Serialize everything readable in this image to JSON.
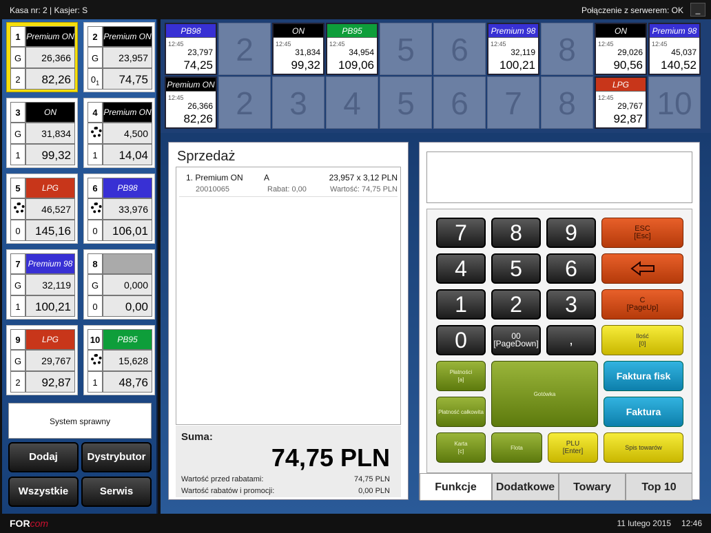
{
  "header": {
    "left": "Kasa nr: 2  |  Kasjer: S",
    "right": "Połączenie z serwerem: OK",
    "min_label": "_"
  },
  "colors": {
    "black": "#000000",
    "red": "#c8361a",
    "blue": "#3830d4",
    "green": "#0e9e3a",
    "gray": "#aaaaaa"
  },
  "pumps": [
    {
      "n": "1",
      "fuel": "Premium ON",
      "fc": "black",
      "g": "G",
      "vol": "26,366",
      "noz": "2",
      "amt": "82,26",
      "sel": true,
      "spin": false
    },
    {
      "n": "2",
      "fuel": "Premium ON",
      "fc": "black",
      "g": "G",
      "vol": "23,957",
      "noz": "0",
      "noz_sub": "1",
      "amt": "74,75",
      "sel": false,
      "spin": false
    },
    {
      "n": "3",
      "fuel": "ON",
      "fc": "black",
      "g": "G",
      "vol": "31,834",
      "noz": "1",
      "amt": "99,32",
      "sel": false,
      "spin": false
    },
    {
      "n": "4",
      "fuel": "Premium ON",
      "fc": "black",
      "g": "",
      "vol": "4,500",
      "noz": "1",
      "amt": "14,04",
      "sel": false,
      "spin": true
    },
    {
      "n": "5",
      "fuel": "LPG",
      "fc": "red",
      "g": "",
      "vol": "46,527",
      "noz": "0",
      "amt": "145,16",
      "sel": false,
      "spin": true
    },
    {
      "n": "6",
      "fuel": "PB98",
      "fc": "blue",
      "g": "",
      "vol": "33,976",
      "noz": "0",
      "amt": "106,01",
      "sel": false,
      "spin": true
    },
    {
      "n": "7",
      "fuel": "Premium 98",
      "fc": "blue",
      "g": "G",
      "vol": "32,119",
      "noz": "1",
      "amt": "100,21",
      "sel": false,
      "spin": false
    },
    {
      "n": "8",
      "fuel": "",
      "fc": "gray",
      "g": "G",
      "vol": "0,000",
      "noz": "0",
      "amt": "0,00",
      "sel": false,
      "spin": false
    },
    {
      "n": "9",
      "fuel": "LPG",
      "fc": "red",
      "g": "G",
      "vol": "29,767",
      "noz": "2",
      "amt": "92,87",
      "sel": false,
      "spin": false
    },
    {
      "n": "10",
      "fuel": "PB95",
      "fc": "green",
      "g": "",
      "vol": "15,628",
      "noz": "1",
      "amt": "48,76",
      "sel": false,
      "spin": true
    }
  ],
  "status": "System sprawny",
  "left_buttons": [
    "Dodaj",
    "Dystrybutor",
    "Wszystkie",
    "Serwis"
  ],
  "transactions_row1": [
    {
      "fuel": "PB98",
      "fc": "blue",
      "time": "12:45",
      "vol": "23,797",
      "amt": "74,25"
    },
    {
      "label": "2"
    },
    {
      "fuel": "ON",
      "fc": "black",
      "time": "12:45",
      "vol": "31,834",
      "amt": "99,32"
    },
    {
      "fuel": "PB95",
      "fc": "green",
      "time": "12:45",
      "vol": "34,954",
      "amt": "109,06"
    },
    {
      "label": "5"
    },
    {
      "label": "6"
    },
    {
      "fuel": "Premium 98",
      "fc": "blue",
      "time": "12:45",
      "vol": "32,119",
      "amt": "100,21"
    },
    {
      "label": "8"
    },
    {
      "fuel": "ON",
      "fc": "black",
      "time": "12:45",
      "vol": "29,026",
      "amt": "90,56"
    },
    {
      "fuel": "Premium 98",
      "fc": "blue",
      "time": "12:45",
      "vol": "45,037",
      "amt": "140,52"
    }
  ],
  "transactions_row2": [
    {
      "fuel": "Premium ON",
      "fc": "black",
      "time": "12:45",
      "vol": "26,366",
      "amt": "82,26"
    },
    {
      "label": "2"
    },
    {
      "label": "3"
    },
    {
      "label": "4"
    },
    {
      "label": "5"
    },
    {
      "label": "6"
    },
    {
      "label": "7"
    },
    {
      "label": "8"
    },
    {
      "fuel": "LPG",
      "fc": "red",
      "time": "12:45",
      "vol": "29,767",
      "amt": "92,87"
    },
    {
      "label": "10"
    }
  ],
  "sale": {
    "title": "Sprzedaż",
    "item": {
      "name": "1. Premium ON",
      "tax": "A",
      "qty": "23,957 x 3,12 PLN",
      "code": "20010065",
      "discount": "Rabat: 0,00",
      "value": "Wartość: 74,75 PLN"
    },
    "sum_label": "Suma:",
    "sum_value": "74,75 PLN",
    "before_label": "Wartość przed rabatami:",
    "before_value": "74,75 PLN",
    "promo_label": "Wartość rabatów i promocji:",
    "promo_value": "0,00 PLN"
  },
  "keys": {
    "k7": "7",
    "k8": "8",
    "k9": "9",
    "k4": "4",
    "k5": "5",
    "k6": "6",
    "k1": "1",
    "k2": "2",
    "k3": "3",
    "k0": "0",
    "k00": "00",
    "k00_sub": "[PageDown]",
    "kcomma": ",",
    "esc": "ESC",
    "esc_sub": "[Esc]",
    "c": "C",
    "c_sub": "[PageUp]",
    "ilosc": "Ilość",
    "ilosc_sub": "[0]",
    "platnosci": "Płatności",
    "platnosci_sub": "[a]",
    "platnosc_calk": "Płatność całkowita",
    "gotowka": "Gotówka",
    "faktura_fisk": "Faktura fisk",
    "faktura": "Faktura",
    "karta": "Karta",
    "karta_sub": "[c]",
    "flota": "Flota",
    "plu": "PLU",
    "plu_sub": "[Enter]",
    "spis": "Spis towarów"
  },
  "tabs": [
    "Funkcje",
    "Dodatkowe",
    "Towary",
    "Top 10"
  ],
  "footer": {
    "logo": "FOR",
    "logo_accent": "com",
    "date": "11 lutego 2015",
    "time": "12:46"
  }
}
